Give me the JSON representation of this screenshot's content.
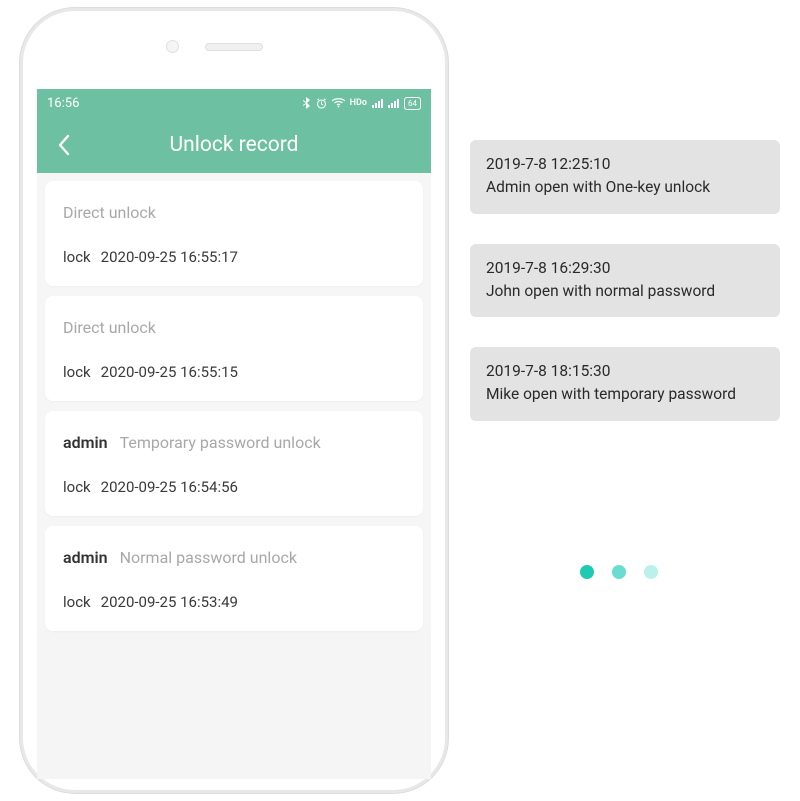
{
  "colors": {
    "accent": "#6dc1a2",
    "pagerDots": [
      "#1fc9b4",
      "#6bdcd1",
      "#bcf0ea"
    ]
  },
  "statusBar": {
    "time": "16:56",
    "hd": "HDo",
    "battery": "64"
  },
  "header": {
    "title": "Unlock record"
  },
  "records": [
    {
      "user": "",
      "type": "Direct unlock",
      "device": "lock",
      "timestamp": "2020-09-25 16:55:17"
    },
    {
      "user": "",
      "type": "Direct unlock",
      "device": "lock",
      "timestamp": "2020-09-25 16:55:15"
    },
    {
      "user": "admin",
      "type": "Temporary password unlock",
      "device": "lock",
      "timestamp": "2020-09-25 16:54:56"
    },
    {
      "user": "admin",
      "type": "Normal password unlock",
      "device": "lock",
      "timestamp": "2020-09-25 16:53:49"
    }
  ],
  "notifications": [
    {
      "time": "2019-7-8 12:25:10",
      "message": "Admin open with One-key unlock"
    },
    {
      "time": "2019-7-8 16:29:30",
      "message": "John open with normal password"
    },
    {
      "time": "2019-7-8 18:15:30",
      "message": "Mike open with temporary password"
    }
  ],
  "pager": {
    "count": 3,
    "active": 0
  }
}
